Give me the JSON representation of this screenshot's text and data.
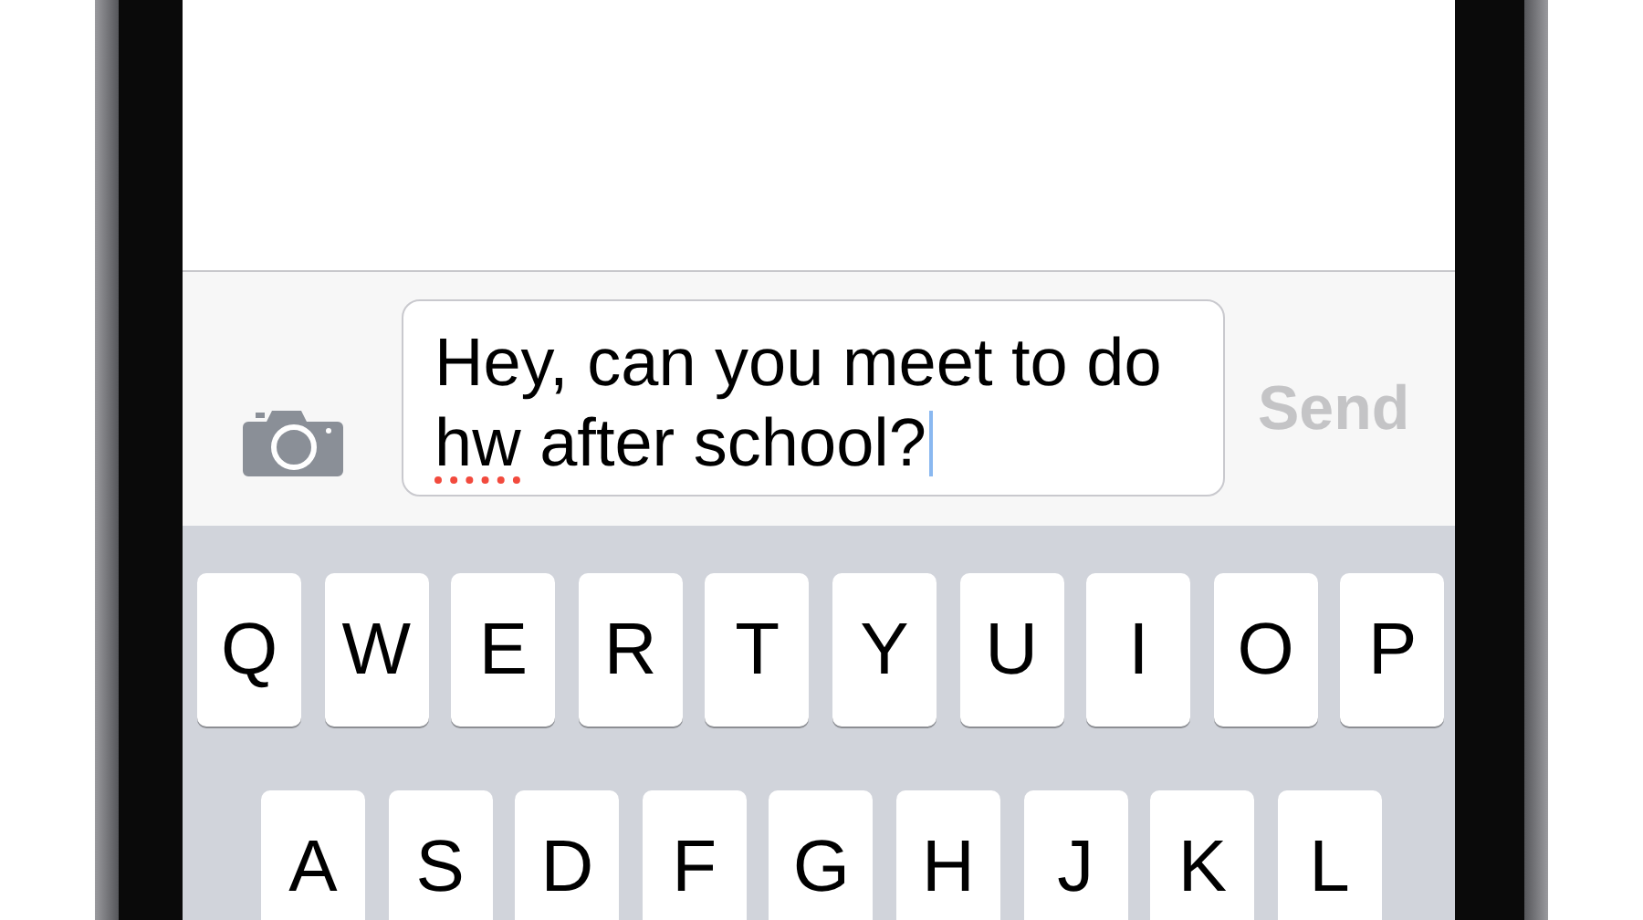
{
  "composer": {
    "segments": [
      {
        "text": "Hey, can you meet to do ",
        "misspelled": false
      },
      {
        "text": "hw",
        "misspelled": true
      },
      {
        "text": " after school?",
        "misspelled": false
      }
    ],
    "focused": true,
    "send_label": "Send",
    "send_disabled": true
  },
  "keyboard": {
    "rows": [
      [
        "Q",
        "W",
        "E",
        "R",
        "T",
        "Y",
        "U",
        "I",
        "O",
        "P"
      ],
      [
        "A",
        "S",
        "D",
        "F",
        "G",
        "H",
        "J",
        "K",
        "L"
      ]
    ]
  }
}
